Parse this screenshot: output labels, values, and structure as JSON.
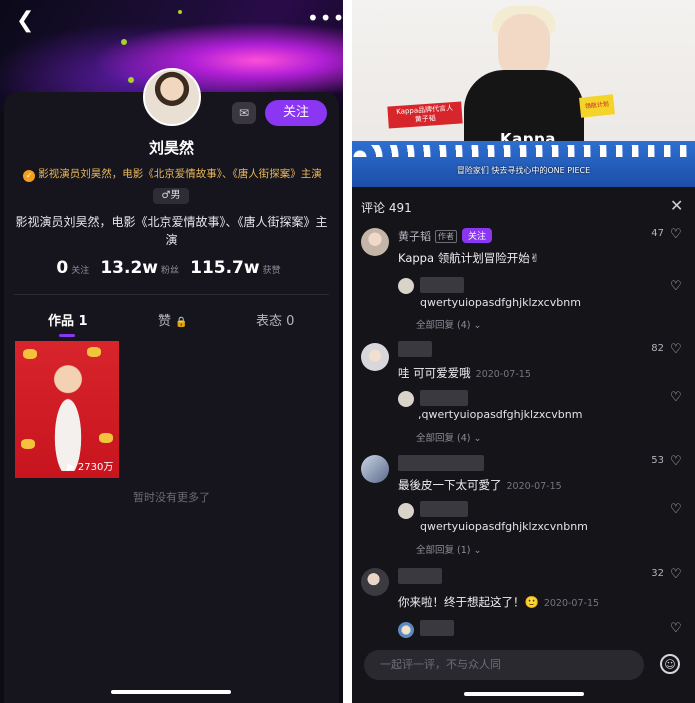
{
  "left": {
    "profile": {
      "name": "刘昊然",
      "verify_text": "影视演员刘昊然，电影《北京爱情故事》、《唐人街探案》主演",
      "gender": "♂男",
      "bio": "影视演员刘昊然，电影《北京爱情故事》、《唐人街探案》主演",
      "follow_label": "关注"
    },
    "stats": [
      {
        "value": "0",
        "label": "关注"
      },
      {
        "value": "13.2w",
        "label": "粉丝"
      },
      {
        "value": "115.7w",
        "label": "获赞"
      }
    ],
    "tabs": {
      "works": "作品 1",
      "likes": "赞",
      "status": "表态 0"
    },
    "video_views": "▶ 2730万",
    "empty_text": "暂时没有更多了",
    "accent_color": "#8a36f2"
  },
  "right": {
    "video": {
      "tag_text": "Kappa品牌代言人\n黄子韬",
      "logo_text": "Kappa",
      "sign_text": "领航计划",
      "subtitle": "冒险家们 快去寻找心中的ONE PIECE"
    },
    "header": {
      "title": "评论 491"
    },
    "comments": [
      {
        "user": "黄子韬",
        "author_tag": "作者",
        "follow": "关注",
        "text": "Kappa 领航计划冒险开始✌",
        "date": "",
        "likes": "47",
        "reply_text": "qwertyuiopasdfghjklzxcvbnm",
        "more": "全部回复 (4) ⌄"
      },
      {
        "user": "",
        "text": "哇 可可爱爱哦",
        "date": "2020-07-15",
        "likes": "82",
        "reply_text": ",qwertyuiopasdfghjklzxcvbnm",
        "more": "全部回复 (4) ⌄"
      },
      {
        "user": "",
        "text": "最後皮一下太可愛了",
        "date": "2020-07-15",
        "likes": "53",
        "reply_text": "qwertyuiopasdfghjklzxcvnbnm",
        "more": "全部回复 (1) ⌄"
      },
      {
        "user": "",
        "text": "你来啦！终于想起这了！🙂",
        "date": "2020-07-15",
        "likes": "32"
      }
    ],
    "input_placeholder": "一起评一评，不与众人同"
  }
}
